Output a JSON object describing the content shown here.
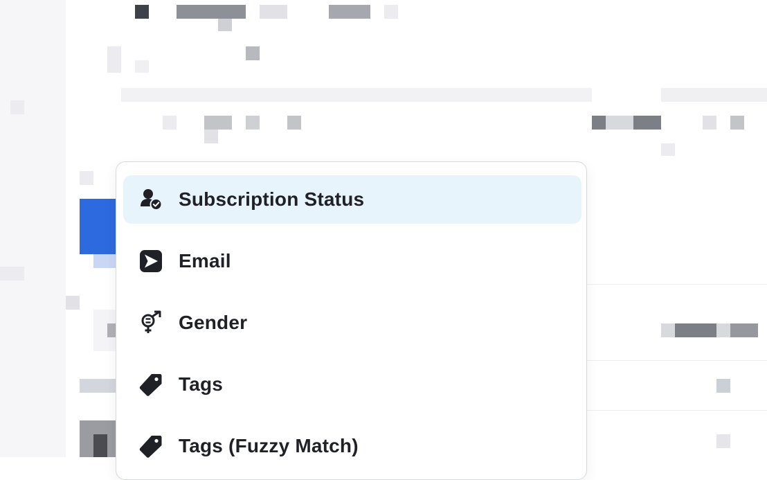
{
  "menu": {
    "items": [
      {
        "label": "Subscription Status",
        "icon": "user-check-icon",
        "selected": true
      },
      {
        "label": "Email",
        "icon": "send-icon",
        "selected": false
      },
      {
        "label": "Gender",
        "icon": "gender-icon",
        "selected": false
      },
      {
        "label": "Tags",
        "icon": "tag-icon",
        "selected": false
      },
      {
        "label": "Tags (Fuzzy Match)",
        "icon": "tag-icon",
        "selected": false
      }
    ]
  },
  "colors": {
    "selected_background": "#e8f4fc",
    "text": "#1f2127",
    "border": "#d5d8de",
    "accent_blue": "#2d6ae0"
  }
}
